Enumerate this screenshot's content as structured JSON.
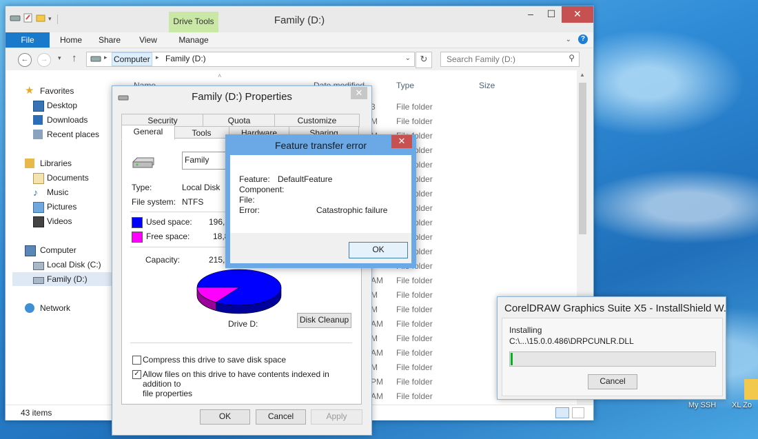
{
  "desktop": {
    "icons": [
      {
        "label": "My SSH"
      },
      {
        "label": "XL Zo"
      }
    ]
  },
  "explorer": {
    "title": "Family (D:)",
    "contextual_tab_group": "Drive Tools",
    "tabs": [
      {
        "label": "File"
      },
      {
        "label": "Home"
      },
      {
        "label": "Share"
      },
      {
        "label": "View"
      },
      {
        "label": "Manage"
      }
    ],
    "address": {
      "crumbs": [
        "Computer",
        "Family (D:)"
      ]
    },
    "search_placeholder": "Search Family (D:)",
    "nav": {
      "favorites": "Favorites",
      "desktop": "Desktop",
      "downloads": "Downloads",
      "recent": "Recent places",
      "libraries": "Libraries",
      "documents": "Documents",
      "music": "Music",
      "pictures": "Pictures",
      "videos": "Videos",
      "computer": "Computer",
      "local_disk": "Local Disk (C:)",
      "family": "Family (D:)",
      "network": "Network"
    },
    "columns": {
      "name": "Name",
      "date": "Date modified",
      "type": "Type",
      "size": "Size"
    },
    "rows": [
      {
        "date": "3",
        "type": "File folder"
      },
      {
        "date": "M",
        "type": "File folder"
      },
      {
        "date": "M",
        "type": "File folder"
      },
      {
        "date": "",
        "type": "File folder"
      },
      {
        "date": "",
        "type": "File folder"
      },
      {
        "date": "",
        "type": "File folder"
      },
      {
        "date": "",
        "type": "File folder"
      },
      {
        "date": "",
        "type": "File folder"
      },
      {
        "date": "",
        "type": "File folder"
      },
      {
        "date": "",
        "type": "File folder"
      },
      {
        "date": "",
        "type": "File folder"
      },
      {
        "date": "",
        "type": "File folder"
      },
      {
        "date": "AM",
        "type": "File folder"
      },
      {
        "date": "M",
        "type": "File folder"
      },
      {
        "date": "M",
        "type": "File folder"
      },
      {
        "date": "AM",
        "type": "File folder"
      },
      {
        "date": "M",
        "type": "File folder"
      },
      {
        "date": "AM",
        "type": "File folder"
      },
      {
        "date": "M",
        "type": "File folder"
      },
      {
        "date": "PM",
        "type": "File folder"
      },
      {
        "date": "AM",
        "type": "File folder"
      }
    ],
    "status": "43 items"
  },
  "properties": {
    "title": "Family (D:) Properties",
    "tabs_top": [
      "Security",
      "Quota",
      "Customize"
    ],
    "tabs_bottom": [
      "General",
      "Tools",
      "Hardware",
      "Sharing"
    ],
    "name_value": "Family",
    "type_label": "Type:",
    "type_value": "Local Disk",
    "fs_label": "File system:",
    "fs_value": "NTFS",
    "used_label": "Used space:",
    "used_value": "196,3",
    "free_label": "Free space:",
    "free_value": "18,8",
    "capacity_label": "Capacity:",
    "capacity_value": "215,2",
    "used_color": "#0000ff",
    "free_color": "#ff00ff",
    "free_fraction": 0.087,
    "drive_label": "Drive D:",
    "disk_cleanup": "Disk Cleanup",
    "compress_label": "Compress this drive to save disk space",
    "compress_checked": false,
    "index_label_1": "Allow files on this drive to have contents indexed in addition to",
    "index_label_2": "file properties",
    "index_checked": true,
    "ok": "OK",
    "cancel": "Cancel",
    "apply": "Apply"
  },
  "error_dialog": {
    "title": "Feature transfer error",
    "feature_label": "Feature:",
    "feature_value": "DefaultFeature",
    "component_label": "Component:",
    "file_label": "File:",
    "error_label": "Error:",
    "error_value": "Catastrophic failure",
    "ok": "OK"
  },
  "installer": {
    "title": "CorelDRAW Graphics Suite X5 - InstallShield W...",
    "status": "Installing",
    "file": "C:\\...\\15.0.0.486\\DRPCUNLR.DLL",
    "progress": 0.01,
    "cancel": "Cancel"
  }
}
